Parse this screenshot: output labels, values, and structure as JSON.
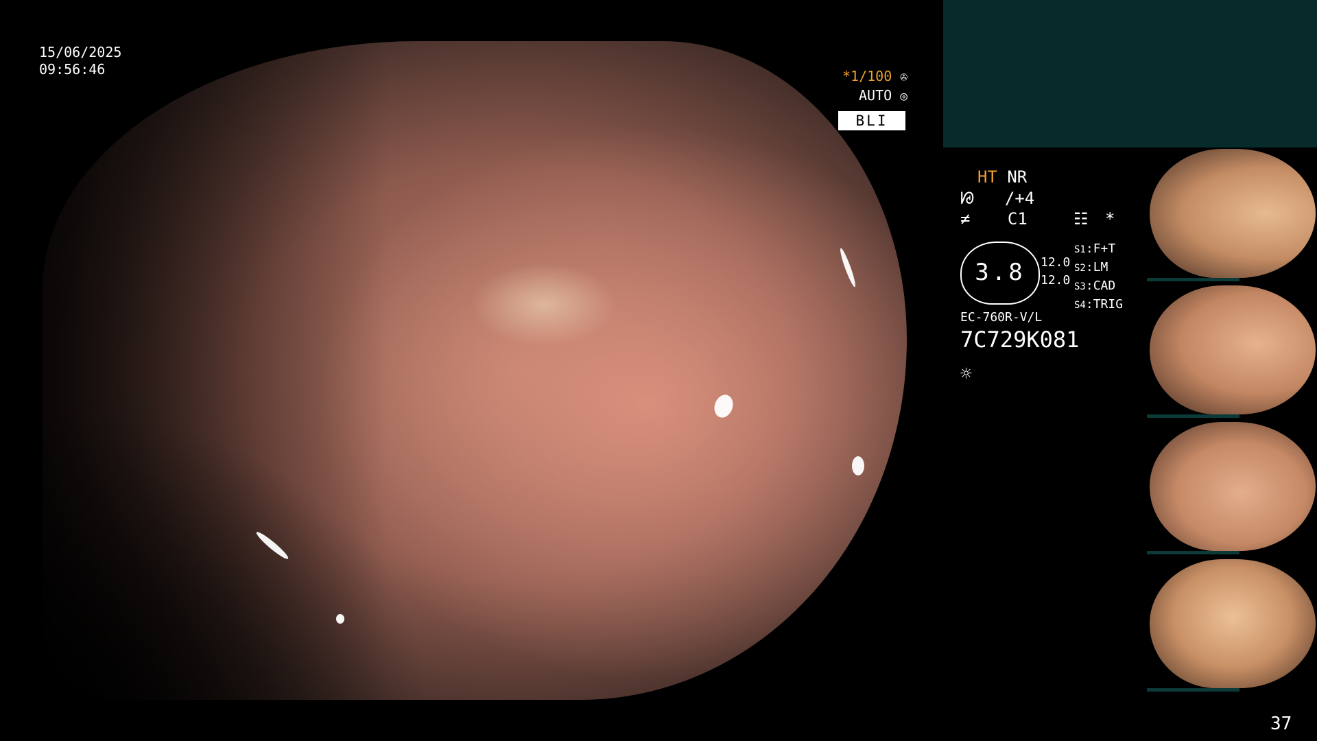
{
  "overlay": {
    "date": "15/06/2025",
    "time": "09:56:46",
    "shutter": "*1/100",
    "shutter_icon": "aperture-icon",
    "exposure": "AUTO",
    "exposure_icon": "iris-icon",
    "mode": "BLI"
  },
  "panel": {
    "ht": "HT",
    "nr": "NR",
    "enhance_value": "/+4",
    "color_value": "C1",
    "star": "*",
    "zoom": "3.8",
    "val_top": "12.0",
    "val_bottom": "12.0",
    "switches": [
      {
        "key": "S1",
        "value": "F+T"
      },
      {
        "key": "S2",
        "value": "LM"
      },
      {
        "key": "S3",
        "value": "CAD"
      },
      {
        "key": "S4",
        "value": "TRIG"
      }
    ],
    "scope_model": "EC-760R-V/L",
    "serial": "7C729K081"
  },
  "colors": {
    "accent": "#f0a030",
    "teal_block": "#062b2a"
  },
  "page_number": "37"
}
